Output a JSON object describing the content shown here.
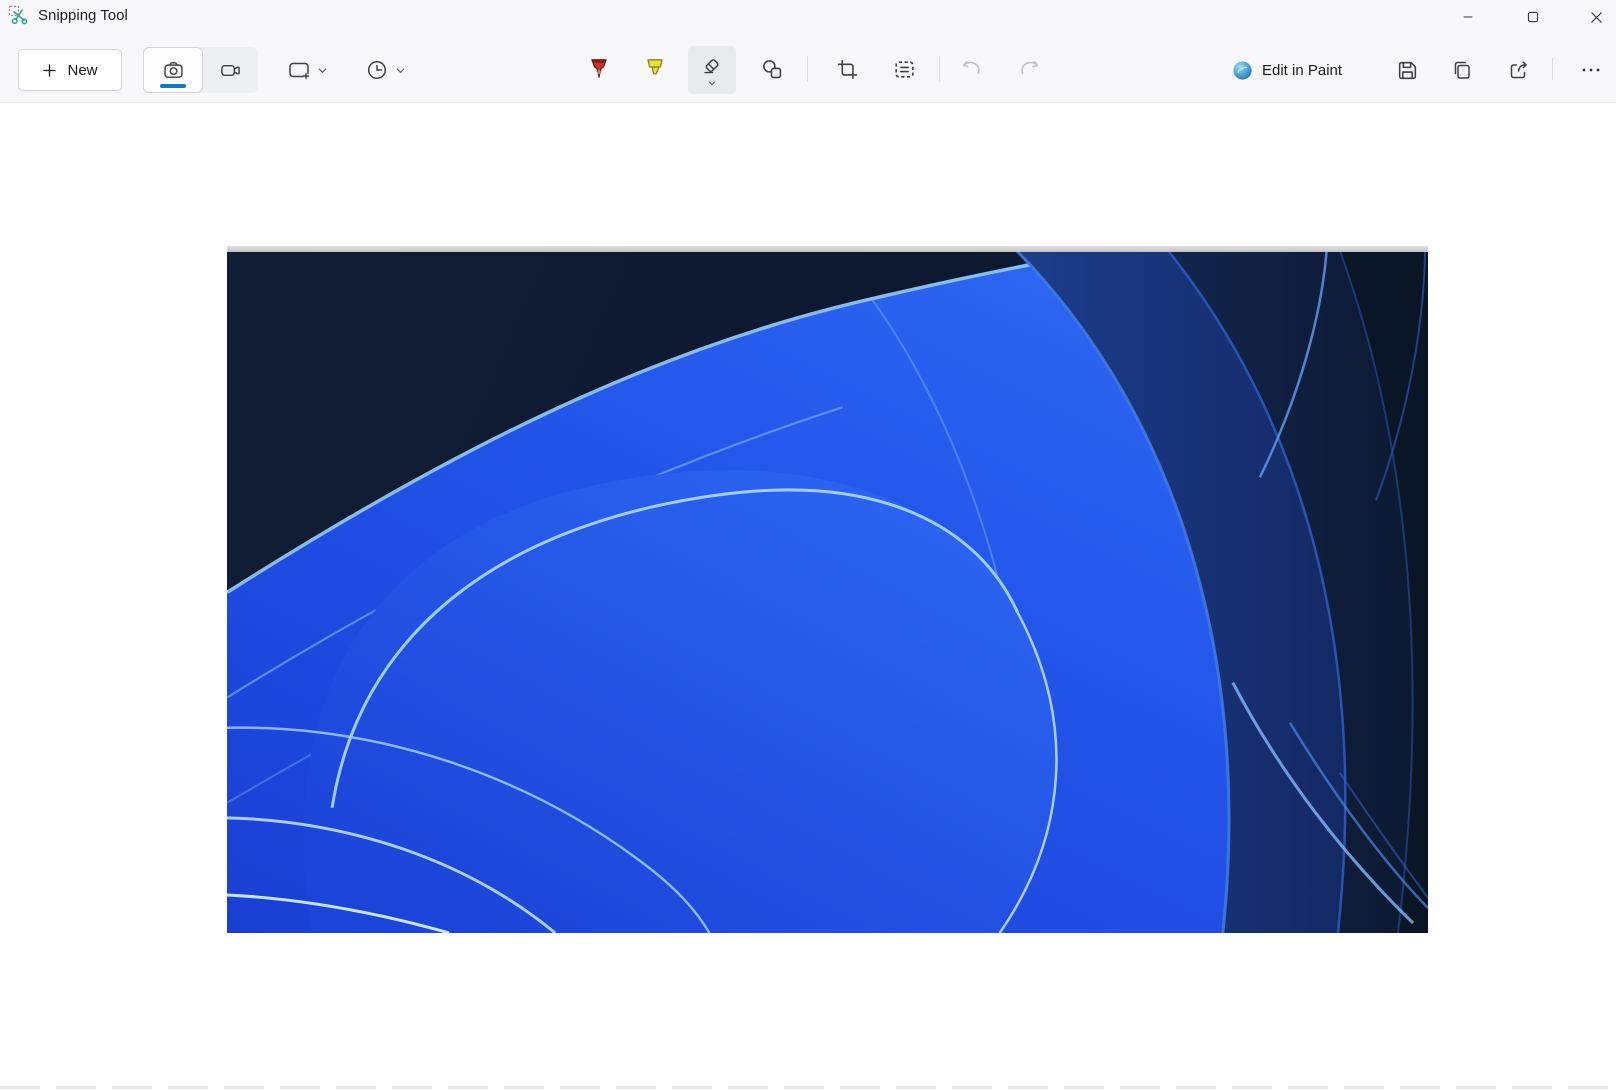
{
  "window": {
    "title": "Snipping Tool",
    "controls": [
      {
        "name": "minimize"
      },
      {
        "name": "maximize"
      },
      {
        "name": "close"
      }
    ]
  },
  "toolbar": {
    "new_button": {
      "label": "New",
      "icon": "plus-icon"
    },
    "capture_modes": [
      {
        "name": "screenshot-mode",
        "icon": "camera-icon",
        "selected": true
      },
      {
        "name": "video-mode",
        "icon": "video-camera-icon",
        "selected": false
      }
    ],
    "snip_shape_dropdown": {
      "icon": "rectangle-snip-icon",
      "chevron": "chevron-down-icon"
    },
    "delay_dropdown": {
      "icon": "clock-icon",
      "chevron": "chevron-down-icon"
    },
    "annotation_tools": [
      {
        "name": "ballpoint-pen",
        "color": "#c9342f",
        "selected": false,
        "disabled": false
      },
      {
        "name": "highlighter",
        "color": "#e6e33c",
        "selected": false,
        "disabled": false
      },
      {
        "name": "eraser",
        "selected": true,
        "disabled": false
      },
      {
        "name": "shapes",
        "selected": false,
        "disabled": false
      },
      {
        "name": "crop",
        "selected": false,
        "disabled": false
      },
      {
        "name": "text-actions",
        "selected": false,
        "disabled": false
      },
      {
        "name": "undo",
        "selected": false,
        "disabled": true
      },
      {
        "name": "redo",
        "selected": false,
        "disabled": true
      }
    ],
    "edit_in_paint_button": {
      "label": "Edit in Paint",
      "icon": "paint-app-icon"
    },
    "file_actions": [
      {
        "name": "save",
        "icon": "save-icon"
      },
      {
        "name": "copy",
        "icon": "copy-icon"
      },
      {
        "name": "share",
        "icon": "share-icon"
      },
      {
        "name": "more-options",
        "icon": "ellipsis-icon"
      }
    ]
  },
  "canvas": {
    "screenshot": {
      "description": "Captured screenshot of the Windows 11 Bloom wallpaper: layered abstract royal-blue ribbon petals with light rim highlights over a dark navy background, light gray strip along the top edge"
    }
  },
  "colors": {
    "accent_underline": "#1874bc",
    "toolbar_background": "#f8f8fa",
    "canvas_background": "#fefefe",
    "wallpaper_bright_blue": "#2254ea",
    "wallpaper_dark_navy": "#0c1830",
    "wallpaper_rim_highlight": "#9fd0f8",
    "screenshot_top_strip": "#cfcfcf"
  }
}
